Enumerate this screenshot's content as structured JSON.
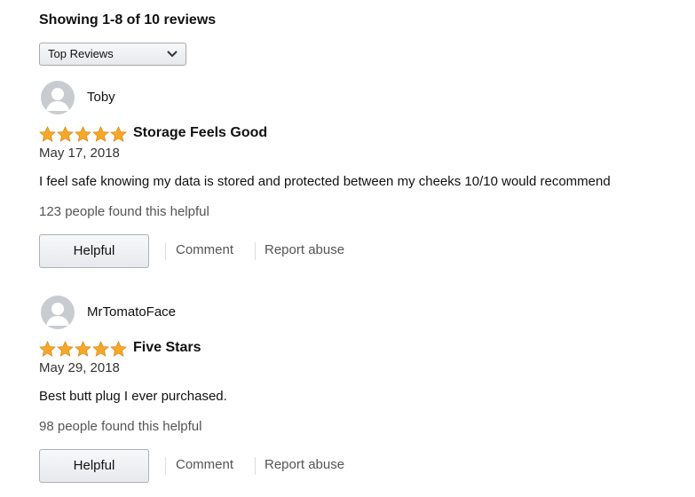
{
  "header": {
    "showing": "Showing 1-8 of 10 reviews"
  },
  "sort": {
    "label": "Top Reviews"
  },
  "colors": {
    "star": "#f7a827",
    "star_stroke": "#d8891c",
    "avatar_bg": "#c8ccd0"
  },
  "reviews": [
    {
      "author": "Toby",
      "rating": 5,
      "title": "Storage Feels Good",
      "date": "May 17, 2018",
      "body": "I feel safe knowing my data is stored and protected between my cheeks 10/10 would recommend",
      "helpful_count": "123 people found this helpful",
      "helpful_label": "Helpful",
      "comment_label": "Comment",
      "report_label": "Report abuse"
    },
    {
      "author": "MrTomatoFace",
      "rating": 5,
      "title": "Five Stars",
      "date": "May 29, 2018",
      "body": "Best butt plug I ever purchased.",
      "helpful_count": "98 people found this helpful",
      "helpful_label": "Helpful",
      "comment_label": "Comment",
      "report_label": "Report abuse"
    }
  ]
}
